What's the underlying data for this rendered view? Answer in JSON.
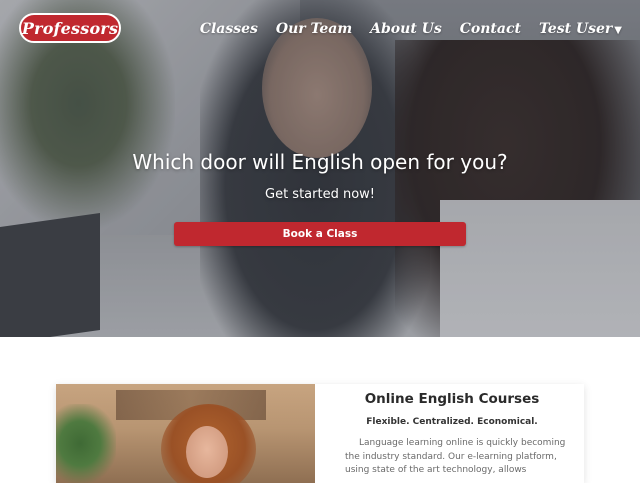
{
  "brand": {
    "name": "Professors",
    "accent": "#c0282f"
  },
  "nav": {
    "items": [
      "Classes",
      "Our Team",
      "About Us",
      "Contact"
    ],
    "user_label": "Test User",
    "user_caret_icon": "caret-down-icon"
  },
  "hero": {
    "headline": "Which door will English open for you?",
    "subheadline": "Get started now!",
    "cta_label": "Book a Class"
  },
  "course_card": {
    "title": "Online English Courses",
    "tagline": "Flexible. Centralized. Economical.",
    "body": "Language learning online is quickly becoming the industry standard. Our e-learning platform, using state of the art technology, allows"
  }
}
